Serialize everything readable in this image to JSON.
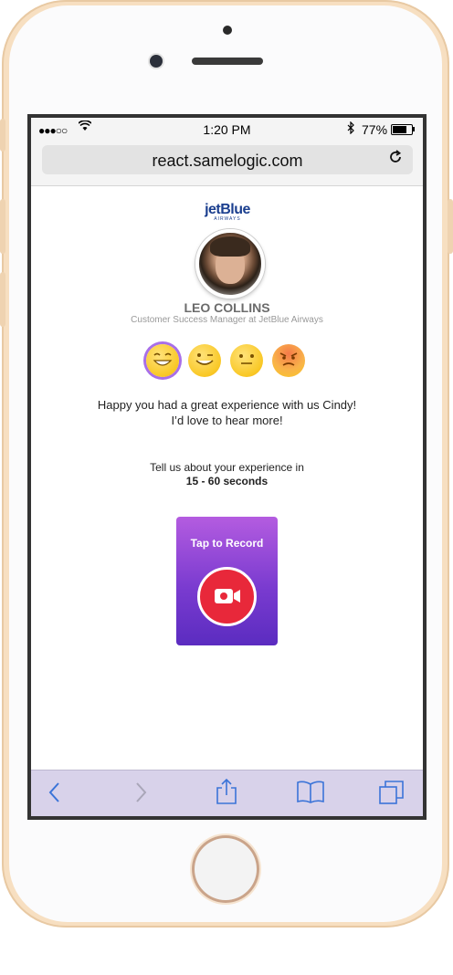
{
  "status": {
    "time": "1:20 PM",
    "battery_pct": "77%",
    "battery_level": 0.77,
    "signal": "●●●○○"
  },
  "browser": {
    "url": "react.samelogic.com"
  },
  "brand": {
    "logo_main": "jetBlue",
    "logo_sub": "AIRWAYS"
  },
  "agent": {
    "name": "LEO COLLINS",
    "title": "Customer Success Manager at JetBlue Airways"
  },
  "ratings": [
    {
      "icon": "laughing-face-icon",
      "selected": true
    },
    {
      "icon": "winking-face-icon",
      "selected": false
    },
    {
      "icon": "neutral-face-icon",
      "selected": false
    },
    {
      "icon": "angry-face-icon",
      "selected": false
    }
  ],
  "message": {
    "line1": "Happy you had a great experience with us Cindy!",
    "line2": "I’d love to hear more!"
  },
  "prompt": {
    "line1": "Tell us about your experience in",
    "duration": "15 - 60 seconds"
  },
  "record": {
    "label": "Tap to Record"
  },
  "colors": {
    "accent_purple": "#7a3bd0",
    "record_red": "#e8283a",
    "ios_blue": "#3b74d8"
  }
}
